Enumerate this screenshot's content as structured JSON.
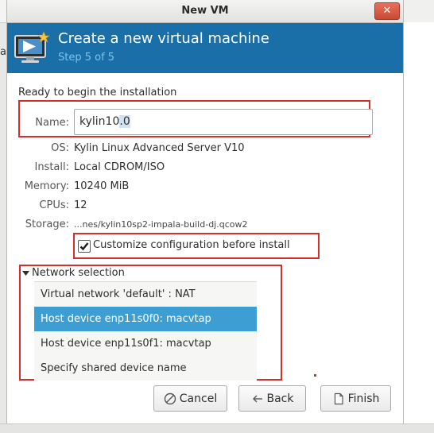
{
  "window": {
    "title": "New VM",
    "close_glyph": "✕"
  },
  "background": {
    "left_letter": "a"
  },
  "header": {
    "title": "Create a new virtual machine",
    "step": "Step 5 of 5",
    "icon": "monitor-star-icon"
  },
  "summary": {
    "ready_text": "Ready to begin the installation",
    "name_label": "Name:",
    "name_value_plain": "kylin10",
    "name_value_selected": ".0",
    "os_label": "OS:",
    "os_value": "Kylin Linux Advanced Server V10",
    "install_label": "Install:",
    "install_value": "Local CDROM/ISO",
    "memory_label": "Memory:",
    "memory_value": "10240 MiB",
    "cpus_label": "CPUs:",
    "cpus_value": "12",
    "storage_label": "Storage:",
    "storage_value": "...nes/kylin10sp2-impala-build-dj.qcow2"
  },
  "customize": {
    "label": "Customize configuration before install",
    "checked": true
  },
  "network": {
    "label": "Network selection",
    "expanded": true,
    "options": [
      {
        "label": "Virtual network 'default' : NAT",
        "selected": false
      },
      {
        "label": "Host device enp11s0f0: macvtap",
        "selected": true
      },
      {
        "label": "Host device enp11s0f1: macvtap",
        "selected": false
      },
      {
        "label": "Specify shared device name",
        "selected": false
      }
    ]
  },
  "buttons": {
    "cancel": "Cancel",
    "back": "Back",
    "finish": "Finish"
  },
  "colors": {
    "banner": "#1a6fa8",
    "step_text": "#7cc3ee",
    "selection": "#3c9ed2",
    "highlight": "#d32f2f"
  }
}
